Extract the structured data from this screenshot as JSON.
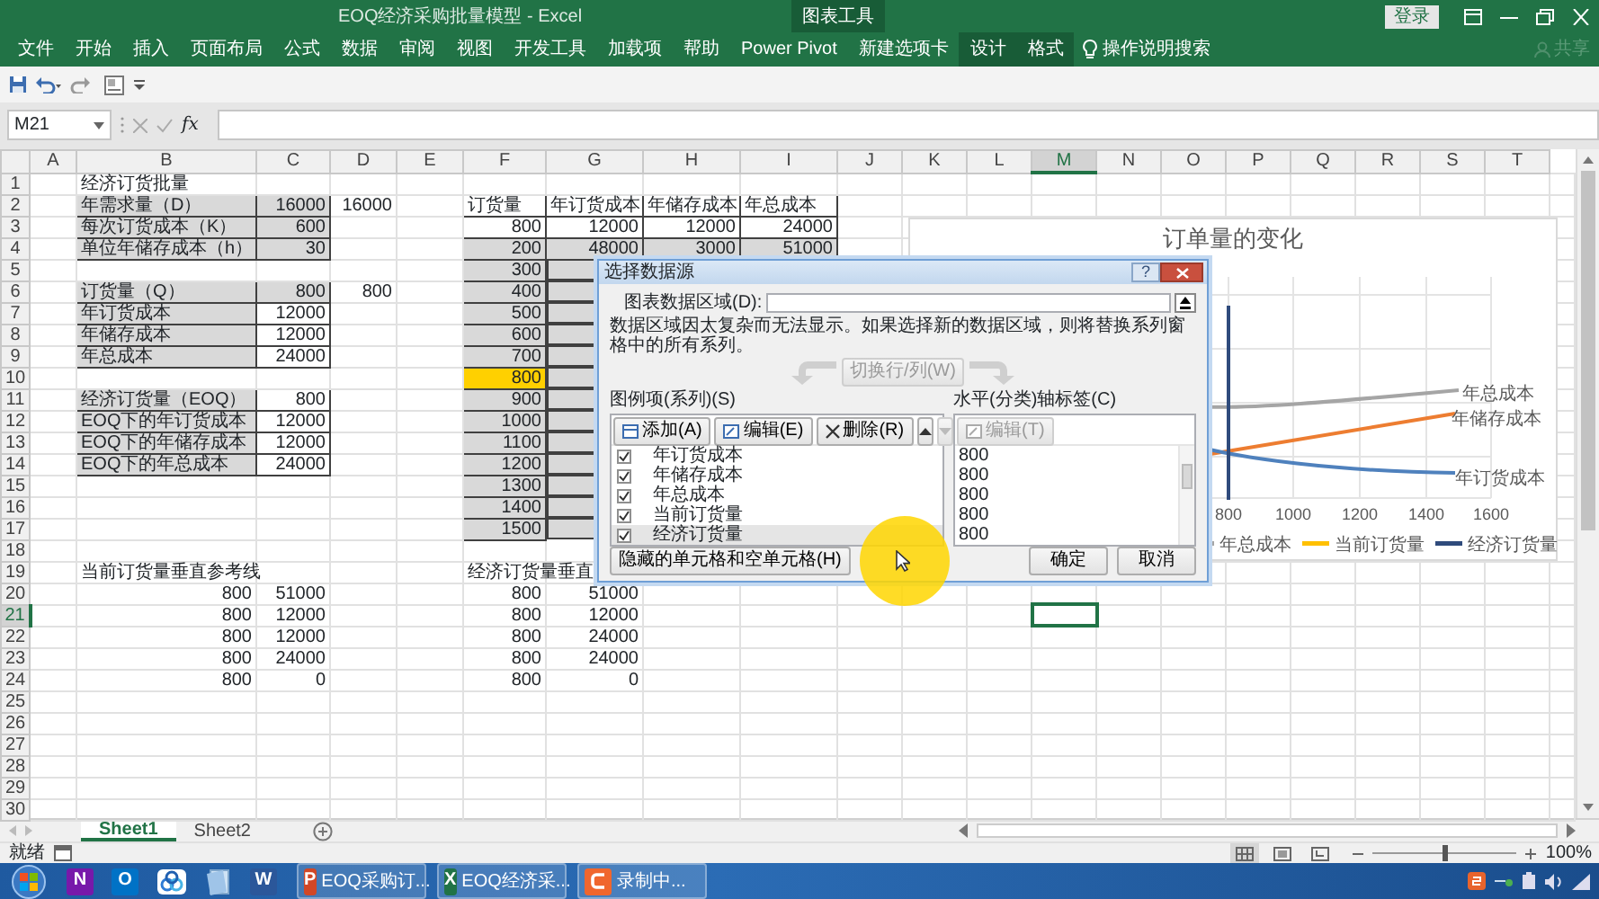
{
  "window": {
    "title": "EOQ经济采购批量模型  -  Excel",
    "context_label": "图表工具",
    "sign_in": "登录"
  },
  "ribbon_tabs": [
    {
      "label": "文件",
      "contextual": false
    },
    {
      "label": "开始",
      "contextual": false
    },
    {
      "label": "插入",
      "contextual": false
    },
    {
      "label": "页面布局",
      "contextual": false
    },
    {
      "label": "公式",
      "contextual": false
    },
    {
      "label": "数据",
      "contextual": false
    },
    {
      "label": "审阅",
      "contextual": false
    },
    {
      "label": "视图",
      "contextual": false
    },
    {
      "label": "开发工具",
      "contextual": false
    },
    {
      "label": "加载项",
      "contextual": false
    },
    {
      "label": "帮助",
      "contextual": false
    },
    {
      "label": "Power Pivot",
      "contextual": false
    },
    {
      "label": "新建选项卡",
      "contextual": false
    },
    {
      "label": "设计",
      "contextual": true
    },
    {
      "label": "格式",
      "contextual": true
    }
  ],
  "tell_me": "操作说明搜索",
  "share": "共享",
  "formula_bar": {
    "name_box": "M21",
    "function_label": "fx"
  },
  "columns": [
    {
      "label": "A",
      "selected": false
    },
    {
      "label": "B",
      "selected": false
    },
    {
      "label": "C",
      "selected": false
    },
    {
      "label": "D",
      "selected": false
    },
    {
      "label": "E",
      "selected": false
    },
    {
      "label": "F",
      "selected": false
    },
    {
      "label": "G",
      "selected": false
    },
    {
      "label": "H",
      "selected": false
    },
    {
      "label": "I",
      "selected": false
    },
    {
      "label": "J",
      "selected": false
    },
    {
      "label": "K",
      "selected": false
    },
    {
      "label": "L",
      "selected": false
    },
    {
      "label": "M",
      "selected": true
    },
    {
      "label": "N",
      "selected": false
    },
    {
      "label": "O",
      "selected": false
    },
    {
      "label": "P",
      "selected": false
    },
    {
      "label": "Q",
      "selected": false
    },
    {
      "label": "R",
      "selected": false
    },
    {
      "label": "S",
      "selected": false
    },
    {
      "label": "T",
      "selected": false
    }
  ],
  "rows": [
    {
      "number": "1",
      "selected": false,
      "cells": {
        "B": {
          "text": "经济订货批量",
          "kind": "heading"
        }
      }
    },
    {
      "number": "2",
      "selected": false,
      "cells": {
        "B": {
          "text": "年需求量（D）",
          "kind": "text",
          "color": "#d9d9d9",
          "boxed": true
        },
        "C": {
          "text": "16000",
          "kind": "number",
          "color": "#d9d9d9",
          "boxed": true
        },
        "D": {
          "text": "16000",
          "kind": "number"
        },
        "F": {
          "text": "订货量",
          "kind": "text",
          "boxed": true
        },
        "G": {
          "text": "年订货成本",
          "kind": "text",
          "boxed": true
        },
        "H": {
          "text": "年储存成本",
          "kind": "text",
          "boxed": true
        },
        "I": {
          "text": "年总成本",
          "kind": "text",
          "boxed": true
        }
      }
    },
    {
      "number": "3",
      "selected": false,
      "cells": {
        "B": {
          "text": "每次订货成本（K）",
          "kind": "text",
          "color": "#d9d9d9",
          "boxed": true
        },
        "C": {
          "text": "600",
          "kind": "number",
          "color": "#d9d9d9",
          "boxed": true
        },
        "F": {
          "text": "800",
          "kind": "number",
          "boxed": true
        },
        "G": {
          "text": "12000",
          "kind": "number",
          "boxed": true
        },
        "H": {
          "text": "12000",
          "kind": "number",
          "boxed": true
        },
        "I": {
          "text": "24000",
          "kind": "number",
          "boxed": true
        }
      }
    },
    {
      "number": "4",
      "selected": false,
      "cells": {
        "B": {
          "text": "单位年储存成本（h）",
          "kind": "text",
          "color": "#d9d9d9",
          "boxed": true
        },
        "C": {
          "text": "30",
          "kind": "number",
          "color": "#d9d9d9",
          "boxed": true
        },
        "F": {
          "text": "200",
          "kind": "number",
          "color": "#d9d9d9",
          "boxed": true
        },
        "G": {
          "text": "48000",
          "kind": "number",
          "color": "#d9d9d9",
          "boxed": true
        },
        "H": {
          "text": "3000",
          "kind": "number",
          "color": "#d9d9d9",
          "boxed": true
        },
        "I": {
          "text": "51000",
          "kind": "number",
          "color": "#d9d9d9",
          "boxed": true
        }
      }
    },
    {
      "number": "5",
      "selected": false,
      "cells": {
        "F": {
          "text": "300",
          "kind": "number",
          "color": "#d9d9d9",
          "boxed": true
        },
        "G": {
          "color": "#d9d9d9",
          "boxed": true
        }
      }
    },
    {
      "number": "6",
      "selected": false,
      "cells": {
        "B": {
          "text": "订货量（Q）",
          "kind": "text",
          "color": "#d9d9d9",
          "boxed": true
        },
        "C": {
          "text": "800",
          "kind": "number",
          "color": "#d9d9d9",
          "boxed": true
        },
        "D": {
          "text": "800",
          "kind": "number"
        },
        "F": {
          "text": "400",
          "kind": "number",
          "color": "#d9d9d9",
          "boxed": true
        },
        "G": {
          "color": "#d9d9d9",
          "boxed": true
        }
      }
    },
    {
      "number": "7",
      "selected": false,
      "cells": {
        "B": {
          "text": "年订货成本",
          "kind": "text",
          "color": "#d9d9d9",
          "boxed": true
        },
        "C": {
          "text": "12000",
          "kind": "number",
          "boxed": true
        },
        "F": {
          "text": "500",
          "kind": "number",
          "color": "#d9d9d9",
          "boxed": true
        },
        "G": {
          "color": "#d9d9d9",
          "boxed": true
        }
      }
    },
    {
      "number": "8",
      "selected": false,
      "cells": {
        "B": {
          "text": "年储存成本",
          "kind": "text",
          "color": "#d9d9d9",
          "boxed": true
        },
        "C": {
          "text": "12000",
          "kind": "number",
          "boxed": true
        },
        "F": {
          "text": "600",
          "kind": "number",
          "color": "#d9d9d9",
          "boxed": true
        },
        "G": {
          "color": "#d9d9d9",
          "boxed": true
        }
      }
    },
    {
      "number": "9",
      "selected": false,
      "cells": {
        "B": {
          "text": "年总成本",
          "kind": "text",
          "color": "#d9d9d9",
          "boxed": true
        },
        "C": {
          "text": "24000",
          "kind": "number",
          "boxed": true
        },
        "F": {
          "text": "700",
          "kind": "number",
          "color": "#d9d9d9",
          "boxed": true
        },
        "G": {
          "color": "#d9d9d9",
          "boxed": true
        }
      }
    },
    {
      "number": "10",
      "selected": false,
      "cells": {
        "F": {
          "text": "800",
          "kind": "number",
          "color": "#ffd000",
          "boxed": true
        },
        "G": {
          "color": "#d9d9d9",
          "boxed": true
        }
      }
    },
    {
      "number": "11",
      "selected": false,
      "cells": {
        "B": {
          "text": "经济订货量（EOQ）",
          "kind": "text",
          "color": "#d9d9d9",
          "boxed": true
        },
        "C": {
          "text": "800",
          "kind": "number",
          "boxed": true
        },
        "F": {
          "text": "900",
          "kind": "number",
          "color": "#d9d9d9",
          "boxed": true
        },
        "G": {
          "color": "#d9d9d9",
          "boxed": true
        }
      }
    },
    {
      "number": "12",
      "selected": false,
      "cells": {
        "B": {
          "text": "EOQ下的年订货成本",
          "kind": "text",
          "color": "#d9d9d9",
          "boxed": true
        },
        "C": {
          "text": "12000",
          "kind": "number",
          "boxed": true
        },
        "F": {
          "text": "1000",
          "kind": "number",
          "color": "#d9d9d9",
          "boxed": true
        },
        "G": {
          "color": "#d9d9d9",
          "boxed": true
        }
      }
    },
    {
      "number": "13",
      "selected": false,
      "cells": {
        "B": {
          "text": "EOQ下的年储存成本",
          "kind": "text",
          "color": "#d9d9d9",
          "boxed": true
        },
        "C": {
          "text": "12000",
          "kind": "number",
          "boxed": true
        },
        "F": {
          "text": "1100",
          "kind": "number",
          "color": "#d9d9d9",
          "boxed": true
        },
        "G": {
          "color": "#d9d9d9",
          "boxed": true
        }
      }
    },
    {
      "number": "14",
      "selected": false,
      "cells": {
        "B": {
          "text": "EOQ下的年总成本",
          "kind": "text",
          "color": "#d9d9d9",
          "boxed": true
        },
        "C": {
          "text": "24000",
          "kind": "number",
          "boxed": true
        },
        "F": {
          "text": "1200",
          "kind": "number",
          "color": "#d9d9d9",
          "boxed": true
        },
        "G": {
          "color": "#d9d9d9",
          "boxed": true
        }
      }
    },
    {
      "number": "15",
      "selected": false,
      "cells": {
        "F": {
          "text": "1300",
          "kind": "number",
          "color": "#d9d9d9",
          "boxed": true
        },
        "G": {
          "color": "#d9d9d9",
          "boxed": true
        }
      }
    },
    {
      "number": "16",
      "selected": false,
      "cells": {
        "F": {
          "text": "1400",
          "kind": "number",
          "color": "#d9d9d9",
          "boxed": true
        },
        "G": {
          "color": "#d9d9d9",
          "boxed": true
        }
      }
    },
    {
      "number": "17",
      "selected": false,
      "cells": {
        "F": {
          "text": "1500",
          "kind": "number",
          "color": "#d9d9d9",
          "boxed": true
        },
        "G": {
          "color": "#d9d9d9",
          "boxed": true
        }
      }
    },
    {
      "number": "18",
      "selected": false
    },
    {
      "number": "19",
      "selected": false,
      "cells": {
        "B": {
          "text": "当前订货量垂直参考线",
          "kind": "heading"
        },
        "F": {
          "text": "经济订货量垂直",
          "kind": "heading"
        }
      }
    },
    {
      "number": "20",
      "selected": false,
      "cells": {
        "B": {
          "text": "800",
          "kind": "number"
        },
        "C": {
          "text": "51000",
          "kind": "number"
        },
        "F": {
          "text": "800",
          "kind": "number"
        },
        "G": {
          "text": "51000",
          "kind": "number"
        }
      }
    },
    {
      "number": "21",
      "selected": true,
      "cells": {
        "B": {
          "text": "800",
          "kind": "number"
        },
        "C": {
          "text": "12000",
          "kind": "number"
        },
        "F": {
          "text": "800",
          "kind": "number"
        },
        "G": {
          "text": "12000",
          "kind": "number"
        }
      }
    },
    {
      "number": "22",
      "selected": false,
      "cells": {
        "B": {
          "text": "800",
          "kind": "number"
        },
        "C": {
          "text": "12000",
          "kind": "number"
        },
        "F": {
          "text": "800",
          "kind": "number"
        },
        "G": {
          "text": "24000",
          "kind": "number"
        }
      }
    },
    {
      "number": "23",
      "selected": false,
      "cells": {
        "B": {
          "text": "800",
          "kind": "number"
        },
        "C": {
          "text": "24000",
          "kind": "number"
        },
        "F": {
          "text": "800",
          "kind": "number"
        },
        "G": {
          "text": "24000",
          "kind": "number"
        }
      }
    },
    {
      "number": "24",
      "selected": false,
      "cells": {
        "B": {
          "text": "800",
          "kind": "number"
        },
        "C": {
          "text": "0",
          "kind": "number"
        },
        "F": {
          "text": "800",
          "kind": "number"
        },
        "G": {
          "text": "0",
          "kind": "number"
        }
      }
    },
    {
      "number": "25",
      "selected": false
    },
    {
      "number": "26",
      "selected": false
    },
    {
      "number": "27",
      "selected": false
    },
    {
      "number": "28",
      "selected": false
    },
    {
      "number": "29",
      "selected": false
    },
    {
      "number": "30",
      "selected": false
    }
  ],
  "chart": {
    "title": "订单量的变化",
    "series_labels": [
      {
        "text": "年总成本",
        "color": "#a5a5a5"
      },
      {
        "text": "年储存成本",
        "color": "#ed7d31"
      },
      {
        "text": "年订货成本",
        "color": "#4f81bd"
      }
    ],
    "x_ticks": [
      "800",
      "1000",
      "1200",
      "1400",
      "1600"
    ],
    "legend": [
      {
        "label": "年总成本",
        "color": "#a5a5a5"
      },
      {
        "label": "当前订货量",
        "color": "#ffc000"
      },
      {
        "label": "经济订货量",
        "color": "#2f4b7c"
      }
    ]
  },
  "dialog": {
    "title": "选择数据源",
    "help": "?",
    "range_label": "图表数据区域(D):",
    "message": "数据区域因太复杂而无法显示。如果选择新的数据区域，则将替换系列窗格中的所有系列。",
    "switch_button": {
      "label": "切换行/列(W)",
      "disabled": true
    },
    "series_heading": "图例项(系列)(S)",
    "series_buttons": [
      {
        "label": "添加(A)",
        "kind": "add",
        "disabled": false
      },
      {
        "label": "编辑(E)",
        "kind": "edit",
        "disabled": false
      },
      {
        "label": "删除(R)",
        "kind": "delete",
        "disabled": false
      }
    ],
    "move_buttons": [
      {
        "kind": "up",
        "disabled": false
      },
      {
        "kind": "down",
        "disabled": true
      }
    ],
    "series": [
      {
        "label": "年订货成本",
        "checked": true,
        "selected": false
      },
      {
        "label": "年储存成本",
        "checked": true,
        "selected": false
      },
      {
        "label": "年总成本",
        "checked": true,
        "selected": false
      },
      {
        "label": "当前订货量",
        "checked": true,
        "selected": false
      },
      {
        "label": "经济订货量",
        "checked": true,
        "selected": true
      }
    ],
    "axis_heading": "水平(分类)轴标签(C)",
    "axis_edit": {
      "label": "编辑(T)",
      "disabled": true
    },
    "axis_values": [
      "800",
      "800",
      "800",
      "800",
      "800"
    ],
    "hidden_cells_button": "隐藏的单元格和空单元格(H)",
    "ok": "确定",
    "cancel": "取消"
  },
  "sheet_tabs": [
    {
      "label": "Sheet1",
      "selected": true
    },
    {
      "label": "Sheet2",
      "selected": false
    }
  ],
  "status_bar": {
    "text": "就绪",
    "views": [
      {
        "kind": "normal",
        "selected": true
      },
      {
        "kind": "page_layout",
        "selected": false
      },
      {
        "kind": "page_break",
        "selected": false
      }
    ],
    "zoom": {
      "level": 0.5
    },
    "zoom_label": "100%"
  },
  "taskbar": {
    "pinned": [
      {
        "kind": "onenote",
        "glyph": "N"
      },
      {
        "kind": "outlook",
        "glyph": "O"
      },
      {
        "kind": "cloud"
      },
      {
        "kind": "notes"
      },
      {
        "kind": "word",
        "glyph": "W"
      }
    ],
    "windows": [
      {
        "kind": "powerpoint",
        "glyph": "P",
        "label": "EOQ采购订..."
      },
      {
        "kind": "excel",
        "glyph": "X",
        "label": "EOQ经济采..."
      },
      {
        "kind": "recorder",
        "label": "录制中..."
      }
    ]
  }
}
